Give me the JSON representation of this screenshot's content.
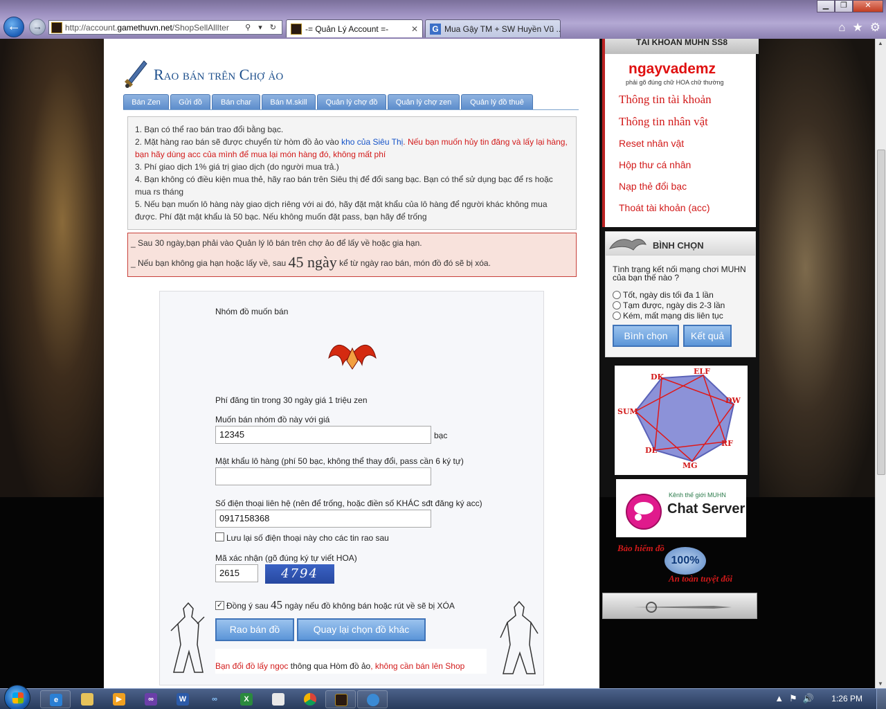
{
  "browser": {
    "url_prefix": "http://account.",
    "url_domain": "gamethuvn.net",
    "url_suffix": "/ShopSellAllIter",
    "address_tools": "⚲ ▾ ↻",
    "tabs": [
      {
        "label": "-= Quản Lý Account =-",
        "close": "✕"
      },
      {
        "label": "Mua Gậy TM + SW Huyền Vũ ..."
      }
    ],
    "window_buttons": [
      "▁",
      "❐",
      "✕"
    ],
    "right_icons": [
      "⌂",
      "★",
      "⚙"
    ]
  },
  "header": {
    "title": "Rao bán trên Chợ ảo",
    "tabs": [
      "Bán Zen",
      "Gửi đồ",
      "Bán char",
      "Bán M.skill",
      "Quản lý chợ đồ",
      "Quản lý chợ zen",
      "Quản lý đồ thuê"
    ]
  },
  "info": {
    "line1": "1. Bạn có thể rao bán trao đổi bằng bạc.",
    "line2_prefix": "2. Mặt hàng rao bán sẽ được chuyển từ hòm đồ ảo vào ",
    "line2_link": "kho của Siêu Thị",
    "line2_red": ". Nếu bạn muốn hủy tin đăng và lấy lại hàng, bạn hãy dùng acc của mình để mua lại món hàng đó, không mất phí",
    "line3": "3. Phí giao dịch 1% giá trị giao dịch (do người mua trả.)",
    "line4": "4. Bạn không có điều kiện mua thẻ, hãy rao bán trên Siêu thị để đổi sang bạc. Bạn có thể sử dụng bạc để rs hoặc mua rs tháng",
    "line5": "5. Nếu bạn muốn lô hàng này giao dịch riêng với ai đó, hãy đặt mật khẩu của lô hàng để người khác không mua được. Phí đặt mật khẩu là 50 bạc. Nếu không muốn đặt pass, bạn hãy để trống"
  },
  "warning": {
    "line1": "_ Sau 30 ngày,bạn phải vào Quản lý lô bán trên chợ ảo để lấy về hoặc gia hạn.",
    "line2_prefix": "_ Nếu bạn không gia hạn hoặc lấy về, sau ",
    "line2_big": "45 ngày",
    "line2_suffix": " kể từ ngày rao bán, món đồ đó sẽ bị xóa."
  },
  "form": {
    "group_label": "Nhóm đồ muốn bán",
    "fee_text": "Phí đăng tin trong 30 ngày giá 1 triệu zen",
    "price_label": "Muốn bán nhóm đồ này với giá",
    "price_value": "12345",
    "price_unit": "bạc",
    "password_label": "Mật khẩu lô hàng (phí 50 bạc, không thể thay đổi, pass cần 6 ký tự)",
    "password_value": "",
    "phone_label": "Số điện thoại liên hệ (nên để trống, hoặc điền số KHÁC sđt đăng ký acc)",
    "phone_value": "0917158368",
    "save_phone_label": "Lưu lại số điện thoại này cho các tin rao sau",
    "save_phone_checked": false,
    "captcha_label": "Mã xác nhận (gõ đúng ký tự viết HOA)",
    "captcha_value": "2615",
    "captcha_image_text": "4794",
    "agree_prefix": "Đồng ý sau ",
    "agree_big": "45",
    "agree_suffix": " ngày nếu đồ không bán hoặc rút về sẽ bị XÓA",
    "agree_checked": true,
    "check_mark": "✓",
    "submit_label": "Rao bán đồ",
    "back_label": "Quay lại chọn đồ khác",
    "note_red1": "Bạn đổi đồ lấy ngọc",
    "note_mid": " thông qua Hòm đồ ảo",
    "note_red2": ", không cần bán lên Shop"
  },
  "sidebar": {
    "account_header": "TÀI KHOẢN MUHN SS8",
    "username": "ngayvademz",
    "hint": "phải gõ đúng chữ HOA chữ thường",
    "links": [
      "Thông tin tài khoản",
      "Thông tin nhân vật",
      "Reset nhân vật",
      "Hộp thư cá nhân",
      "Nạp thẻ đổi bạc",
      "Thoát tài khoản (acc)"
    ],
    "poll_title": "BÌNH CHỌN",
    "poll_question": "Tình trạng kết nối mạng chơi MUHN của bạn thế nào ?",
    "poll_options": [
      "Tốt, ngày dis tối đa 1 lần",
      "Tạm được, ngày dis 2-3 lần",
      "Kém, mất mạng dis liên tục"
    ],
    "vote_label": "Bình chọn",
    "result_label": "Kết quả",
    "classes": [
      "DK",
      "ELF",
      "DW",
      "RF",
      "MG",
      "DL",
      "SUM"
    ],
    "chat_small": "Kênh thế giới MUHN",
    "chat_big": "Chat Server",
    "insure_top": "Bảo hiểm đồ",
    "insure_pct": "100%",
    "insure_bottom": "An toàn tuyệt đối"
  },
  "taskbar": {
    "clock": "1:26 PM",
    "tray": [
      "▲",
      "⚑",
      "🔊"
    ]
  },
  "colors": {
    "title_blue": "#1d4f8c",
    "link_red": "#d21a1a",
    "button_blue": "#5b95d8"
  }
}
